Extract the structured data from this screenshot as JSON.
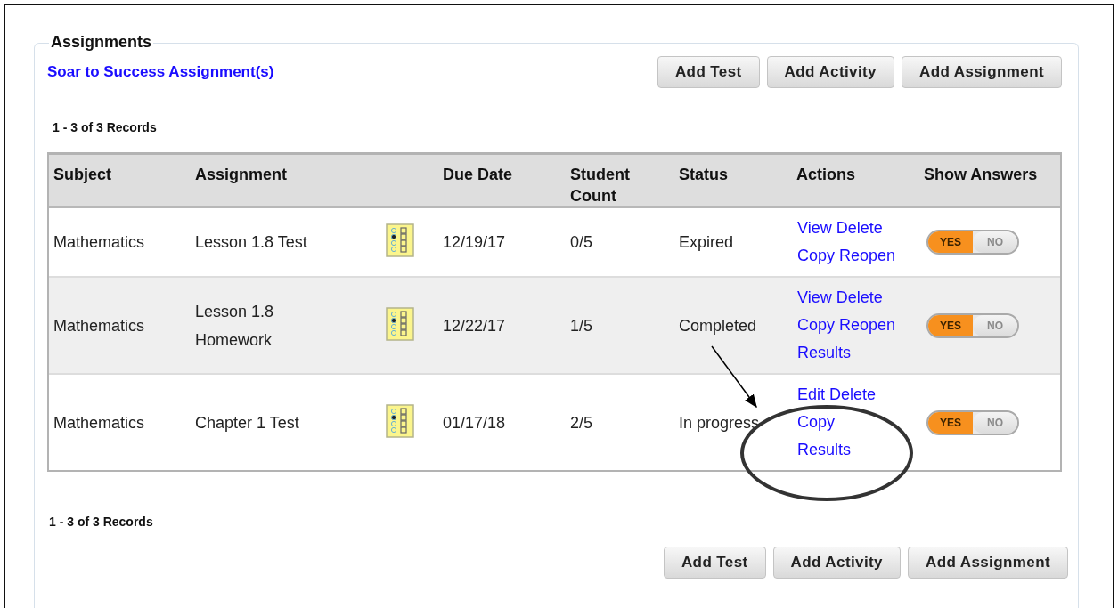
{
  "panel": {
    "legend": "Assignments",
    "program_link": "Soar to Success Assignment(s)"
  },
  "top_buttons": [
    "Add Test",
    "Add Activity",
    "Add Assignment"
  ],
  "records_top": "1 - 3 of 3 Records",
  "table": {
    "columns": [
      "Subject",
      "Assignment",
      "Due Date",
      "Student Count",
      "Status",
      "Actions",
      "Show Answers"
    ],
    "rows": [
      {
        "subject": "Mathematics",
        "assignment": "Lesson 1.8 Test",
        "due_date": "12/19/17",
        "student_count": "0/5",
        "status": "Expired",
        "actions": [
          [
            "View",
            "Delete"
          ],
          [
            "Copy",
            "Reopen"
          ]
        ],
        "show_answers": {
          "on": true,
          "yes": "YES",
          "no": "NO"
        }
      },
      {
        "subject": "Mathematics",
        "assignment": "Lesson 1.8 Homework",
        "due_date": "12/22/17",
        "student_count": "1/5",
        "status": "Completed",
        "actions": [
          [
            "View",
            "Delete"
          ],
          [
            "Copy",
            "Reopen"
          ],
          [
            "Results"
          ]
        ],
        "show_answers": {
          "on": true,
          "yes": "YES",
          "no": "NO"
        }
      },
      {
        "subject": "Mathematics",
        "assignment": "Chapter 1 Test",
        "due_date": "01/17/18",
        "student_count": "2/5",
        "status": "In progress",
        "actions": [
          [
            "Edit",
            "Delete"
          ],
          [
            "Copy"
          ],
          [
            "Results"
          ]
        ],
        "show_answers": {
          "on": true,
          "yes": "YES",
          "no": "NO"
        }
      }
    ]
  },
  "records_bottom": "1 - 3 of 3 Records",
  "bottom_buttons": [
    "Add Test",
    "Add Activity",
    "Add Assignment"
  ]
}
